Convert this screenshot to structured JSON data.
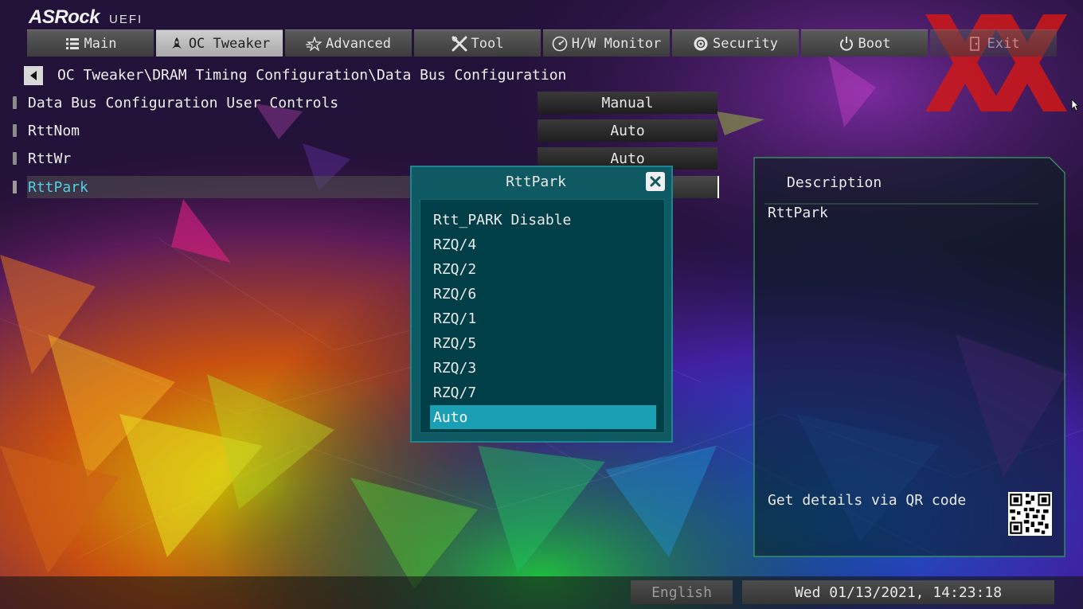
{
  "brand": {
    "name": "ASRock",
    "sub": "UEFI"
  },
  "tabs": [
    {
      "label": "Main",
      "icon": "list-icon"
    },
    {
      "label": "OC Tweaker",
      "icon": "rocket-icon"
    },
    {
      "label": "Advanced",
      "icon": "star-icon"
    },
    {
      "label": "Tool",
      "icon": "wrench-icon"
    },
    {
      "label": "H/W Monitor",
      "icon": "monitor-icon"
    },
    {
      "label": "Security",
      "icon": "shield-icon"
    },
    {
      "label": "Boot",
      "icon": "power-icon"
    },
    {
      "label": "Exit",
      "icon": "exit-icon"
    }
  ],
  "active_tab": "OC Tweaker",
  "breadcrumb": "OC Tweaker\\DRAM Timing Configuration\\Data Bus Configuration",
  "settings": [
    {
      "label": "Data Bus Configuration User Controls",
      "value": "Manual"
    },
    {
      "label": "RttNom",
      "value": "Auto"
    },
    {
      "label": "RttWr",
      "value": "Auto"
    },
    {
      "label": "RttPark",
      "value": "Auto"
    }
  ],
  "popup": {
    "title": "RttPark",
    "options": [
      "Rtt_PARK Disable",
      "RZQ/4",
      "RZQ/2",
      "RZQ/6",
      "RZQ/1",
      "RZQ/5",
      "RZQ/3",
      "RZQ/7",
      "Auto"
    ],
    "selected": "Auto"
  },
  "description": {
    "title": "Description",
    "text": "RttPark",
    "qr_label": "Get details via QR code"
  },
  "footer": {
    "language": "English",
    "datetime": "Wed 01/13/2021, 14:23:18"
  }
}
